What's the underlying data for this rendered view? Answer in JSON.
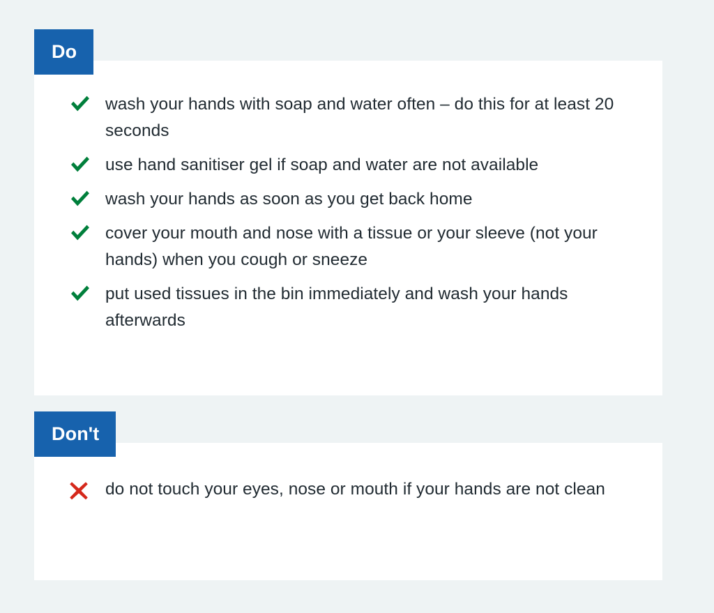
{
  "theme": {
    "background": "#eef3f4",
    "card_background": "#ffffff",
    "header_blue": "#1762ad",
    "header_text": "#ffffff",
    "tick_green": "#007f3b",
    "cross_red": "#d5281b",
    "body_text": "#212b32"
  },
  "blocks": [
    {
      "id": "do",
      "header_label": "Do",
      "icon": "green-tick-icon",
      "items": [
        "wash your hands with soap and water often – do this for at least 20 seconds",
        "use hand sanitiser gel if soap and water are not available",
        "wash your hands as soon as you get back home",
        "cover your mouth and nose with a tissue or your sleeve (not your hands) when you cough or sneeze",
        "put used tissues in the bin immediately and wash your hands afterwards"
      ]
    },
    {
      "id": "dont",
      "header_label": "Don't",
      "icon": "red-cross-icon",
      "items": [
        "do not touch your eyes, nose or mouth if your hands are not clean"
      ]
    }
  ]
}
